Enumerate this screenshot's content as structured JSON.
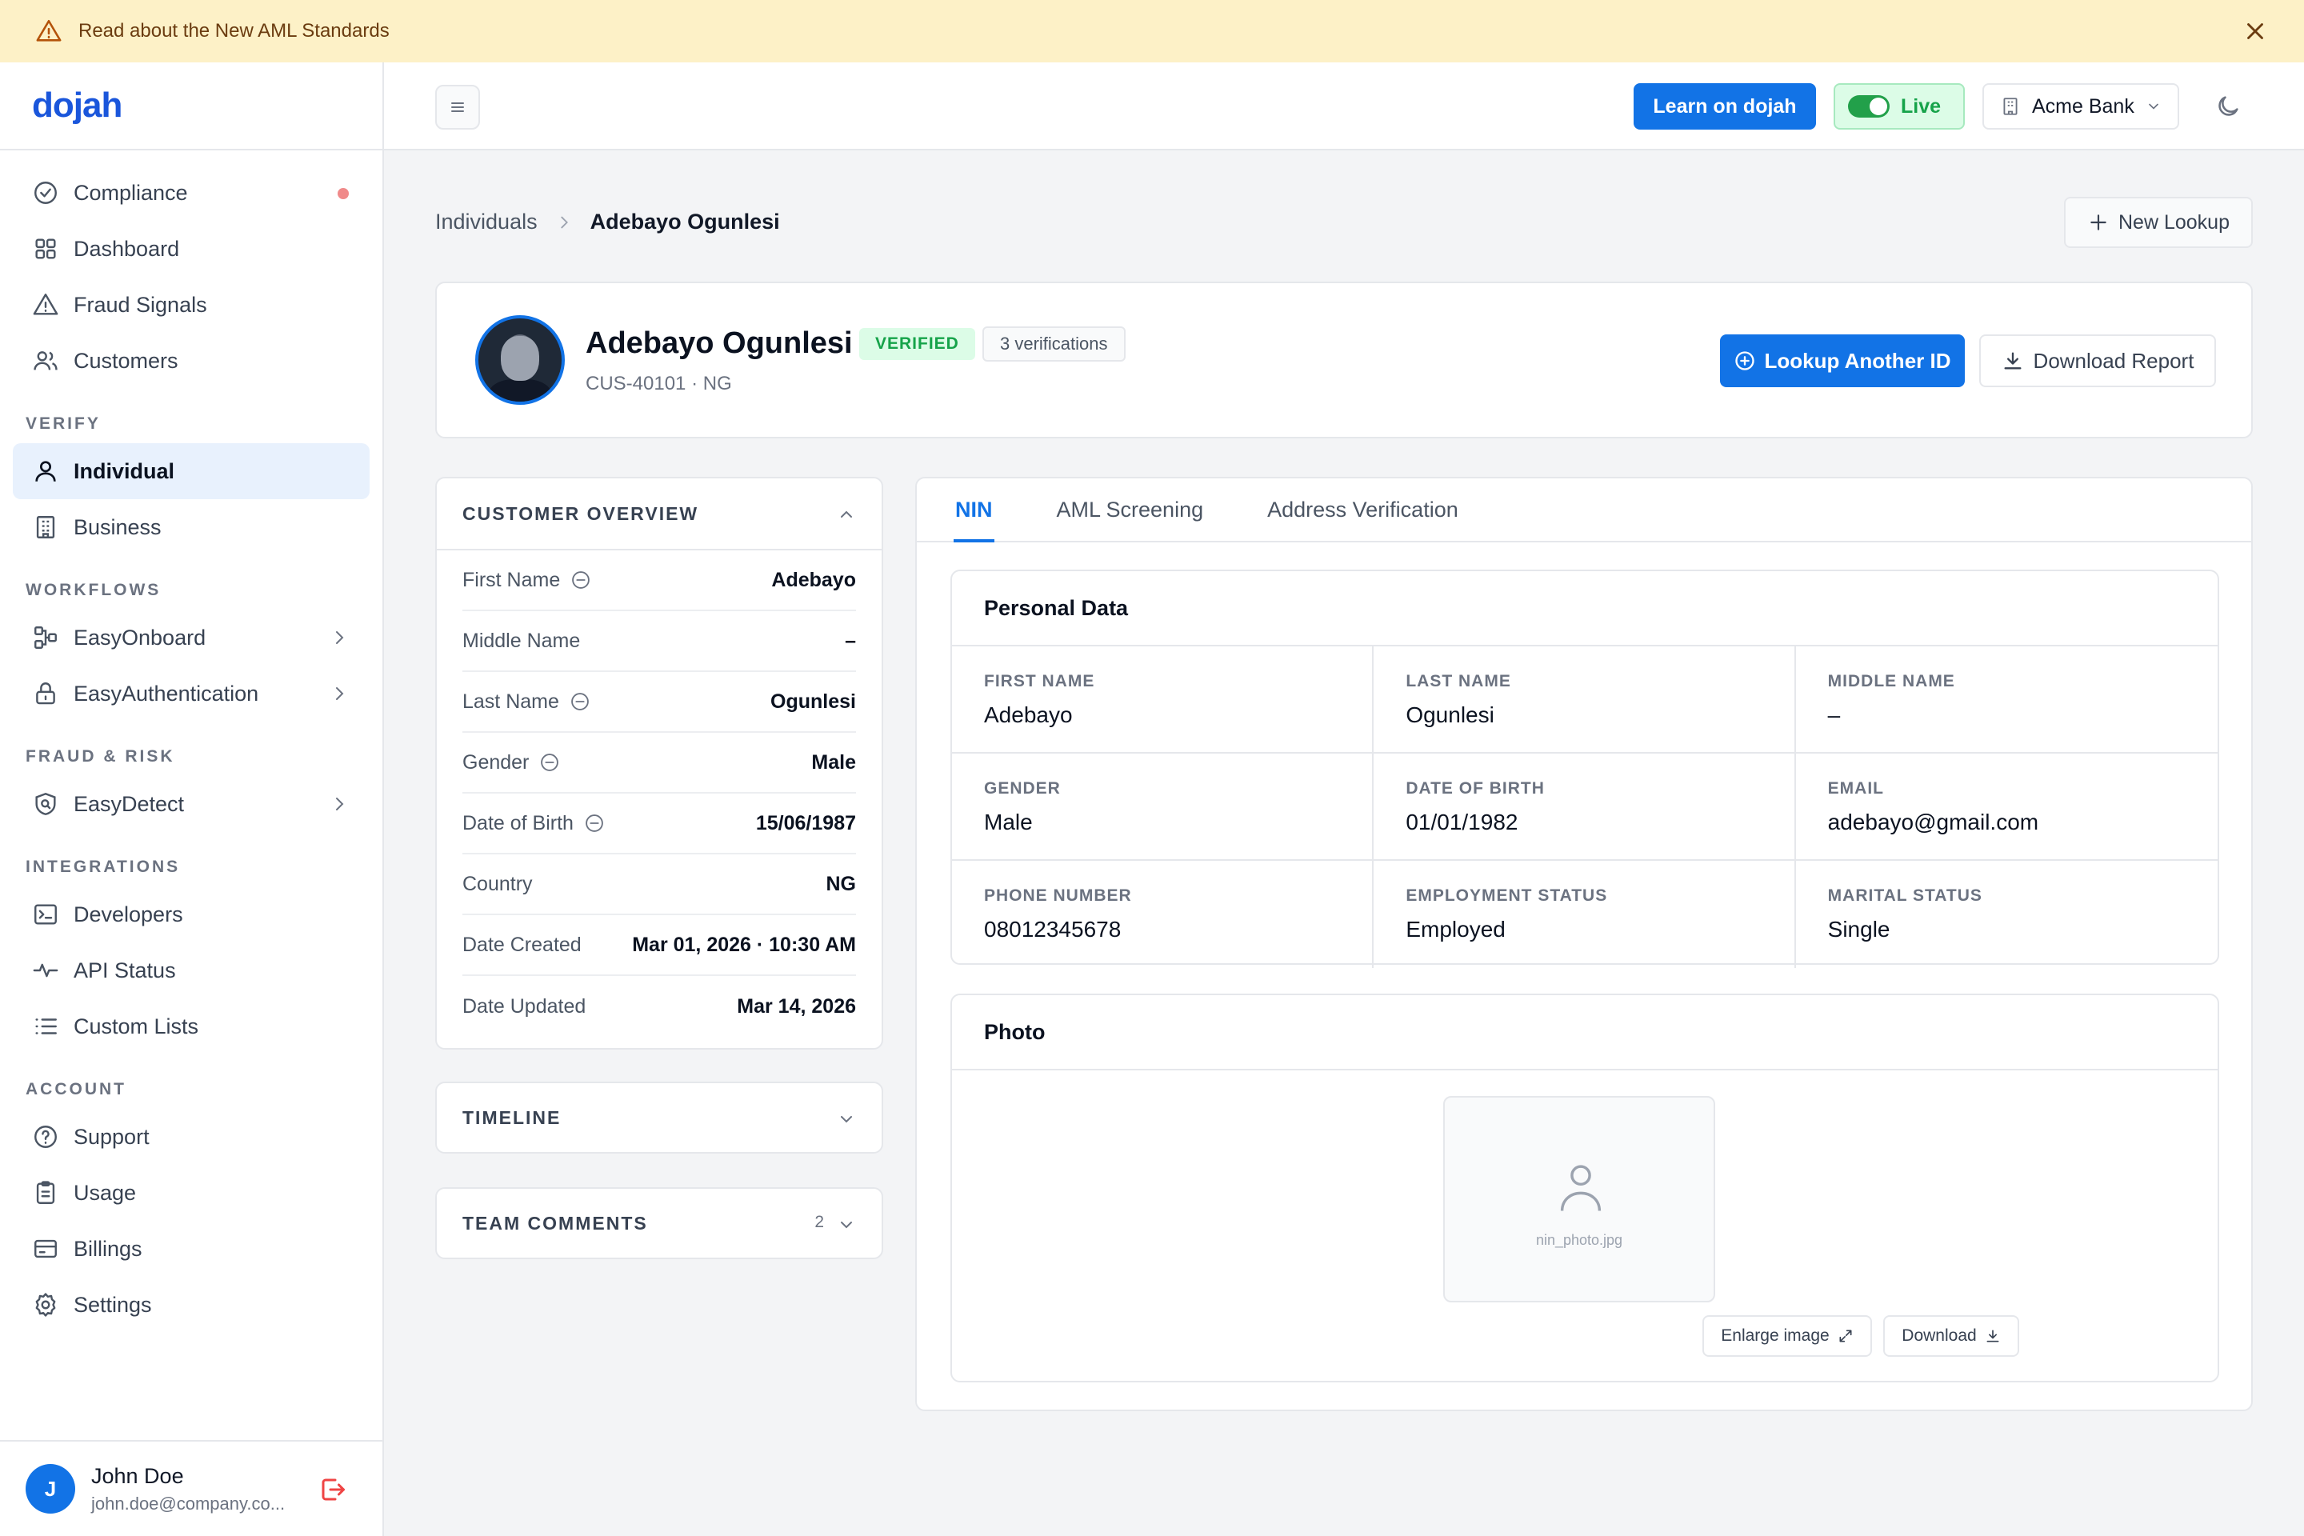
{
  "banner": {
    "text": "Read about the New AML Standards"
  },
  "brand": {
    "logo": "dojah",
    "accent": "#1273e6"
  },
  "sidebar": {
    "top_items": [
      {
        "label": "Compliance",
        "icon": "check-circle-icon"
      },
      {
        "label": "Dashboard",
        "icon": "grid-icon"
      },
      {
        "label": "Fraud Signals",
        "icon": "warning-icon"
      },
      {
        "label": "Customers",
        "icon": "users-icon"
      }
    ],
    "sections": {
      "verify": "VERIFY",
      "workflows": "WORKFLOWS",
      "fraud": "FRAUD & RISK",
      "integrations": "INTEGRATIONS",
      "account": "ACCOUNT"
    },
    "verify_items": [
      "Individual",
      "Business"
    ],
    "workflow_items": [
      "EasyOnboard",
      "EasyAuthentication"
    ],
    "fraud_items": [
      "EasyDetect"
    ],
    "integration_items": [
      "Developers",
      "API Status",
      "Custom Lists"
    ],
    "account_items": [
      "Support",
      "Usage",
      "Billings",
      "Settings"
    ],
    "user": {
      "initial": "J",
      "name": "John Doe",
      "email": "john.doe@company.co..."
    }
  },
  "topbar": {
    "learn_label": "Learn on dojah",
    "live_label": "Live",
    "bank_label": "Acme Bank"
  },
  "breadcrumb": {
    "parent": "Individuals",
    "current": "Adebayo Ogunlesi"
  },
  "new_lookup_label": "New Lookup",
  "profile": {
    "name": "Adebayo Ogunlesi",
    "badge": "VERIFIED",
    "verifications": "3 verifications",
    "id_line": "CUS-40101 · NG",
    "lookup_label": "Lookup Another ID",
    "download_label": "Download Report"
  },
  "overview": {
    "title": "CUSTOMER OVERVIEW",
    "rows": [
      {
        "label": "First Name",
        "value": "Adebayo"
      },
      {
        "label": "Middle Name",
        "value": "–"
      },
      {
        "label": "Last Name",
        "value": "Ogunlesi"
      },
      {
        "label": "Gender",
        "value": "Male"
      },
      {
        "label": "Date of Birth",
        "value": "15/06/1987"
      },
      {
        "label": "Country",
        "value": "NG"
      },
      {
        "label": "Date Created",
        "value": "Mar 01, 2026 · 10:30 AM"
      },
      {
        "label": "Date Updated",
        "value": "Mar 14, 2026"
      }
    ]
  },
  "timeline": {
    "title": "TIMELINE"
  },
  "comments": {
    "title": "TEAM COMMENTS",
    "count": "2"
  },
  "tabs": [
    "NIN",
    "AML Screening",
    "Address Verification"
  ],
  "personal_data": {
    "title": "Personal Data",
    "fields": [
      {
        "key": "FIRST NAME",
        "value": "Adebayo"
      },
      {
        "key": "LAST NAME",
        "value": "Ogunlesi"
      },
      {
        "key": "MIDDLE NAME",
        "value": "–"
      },
      {
        "key": "GENDER",
        "value": "Male"
      },
      {
        "key": "DATE OF BIRTH",
        "value": "01/01/1982"
      },
      {
        "key": "EMAIL",
        "value": "adebayo@gmail.com"
      },
      {
        "key": "PHONE NUMBER",
        "value": "08012345678"
      },
      {
        "key": "EMPLOYMENT STATUS",
        "value": "Employed"
      },
      {
        "key": "MARITAL STATUS",
        "value": "Single"
      }
    ]
  },
  "photo": {
    "title": "Photo",
    "filename": "nin_photo.jpg",
    "enlarge_label": "Enlarge image",
    "download_label": "Download"
  }
}
